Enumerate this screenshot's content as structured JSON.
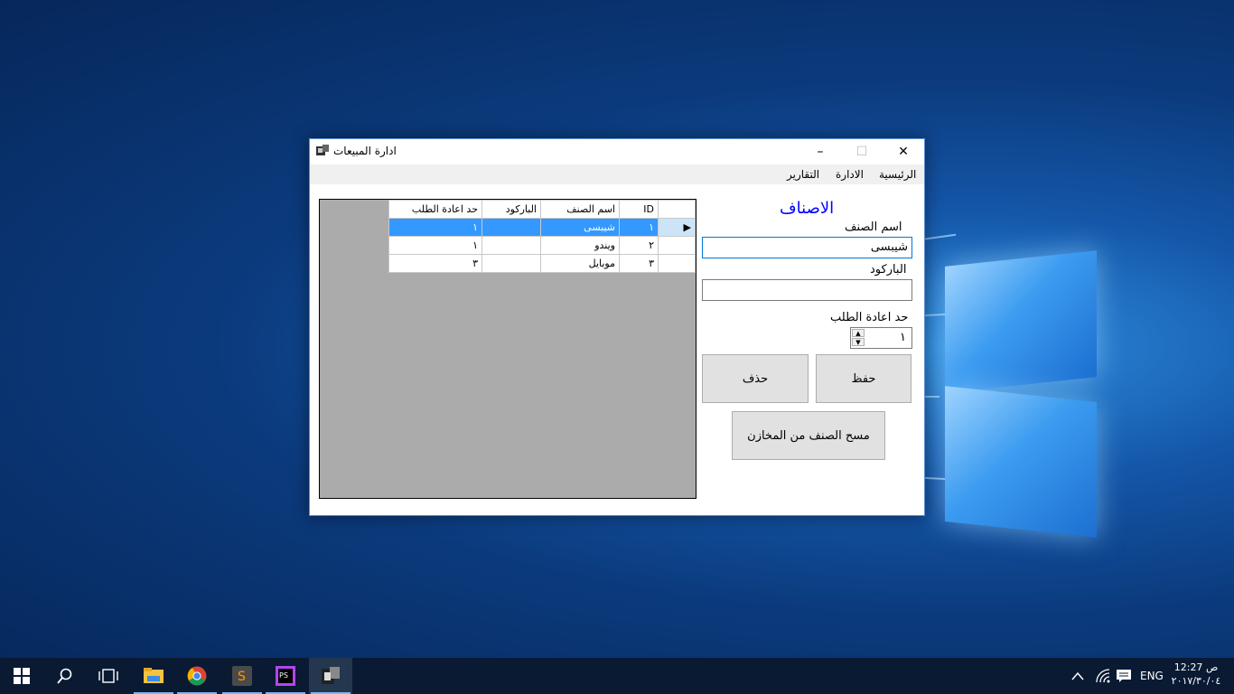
{
  "window": {
    "title": "ادارة المبيعات",
    "minimize_glyph": "–",
    "maximize_glyph": "☐",
    "close_glyph": "✕"
  },
  "menu": [
    "الرئيسية",
    "الادارة",
    "التقارير"
  ],
  "grid": {
    "columns": [
      "ID",
      "اسم الصنف",
      "الباركود",
      "حد اعادة الطلب"
    ],
    "rows": [
      {
        "id": "١",
        "name": "شيبسى",
        "barcode": "",
        "reorder": "١",
        "selected": true
      },
      {
        "id": "٢",
        "name": "ويندو",
        "barcode": "",
        "reorder": "١",
        "selected": false
      },
      {
        "id": "٣",
        "name": "موبايل",
        "barcode": "",
        "reorder": "٣",
        "selected": false
      }
    ]
  },
  "form": {
    "title": "الاصناف",
    "name_label": "اسم الصنف",
    "name_value": "شيبسى",
    "barcode_label": "الباركود",
    "barcode_value": "",
    "reorder_label": "حد اعادة الطلب",
    "reorder_value": "١",
    "save_button": "حفظ",
    "delete_button": "حذف",
    "clear_stock_button": "مسح الصنف من المخازن"
  },
  "taskbar": {
    "language": "ENG",
    "time": "12:27 ص",
    "date": "٢٠١٧/٣٠/٠٤",
    "apps": [
      "start",
      "search",
      "task-view",
      "file-explorer",
      "chrome",
      "sublime-text",
      "phpstorm",
      "sales-app"
    ]
  },
  "colors": {
    "accent": "#0078d7",
    "selection": "#3399ff",
    "form_title": "#0000ff",
    "grid_background": "#ababab"
  }
}
